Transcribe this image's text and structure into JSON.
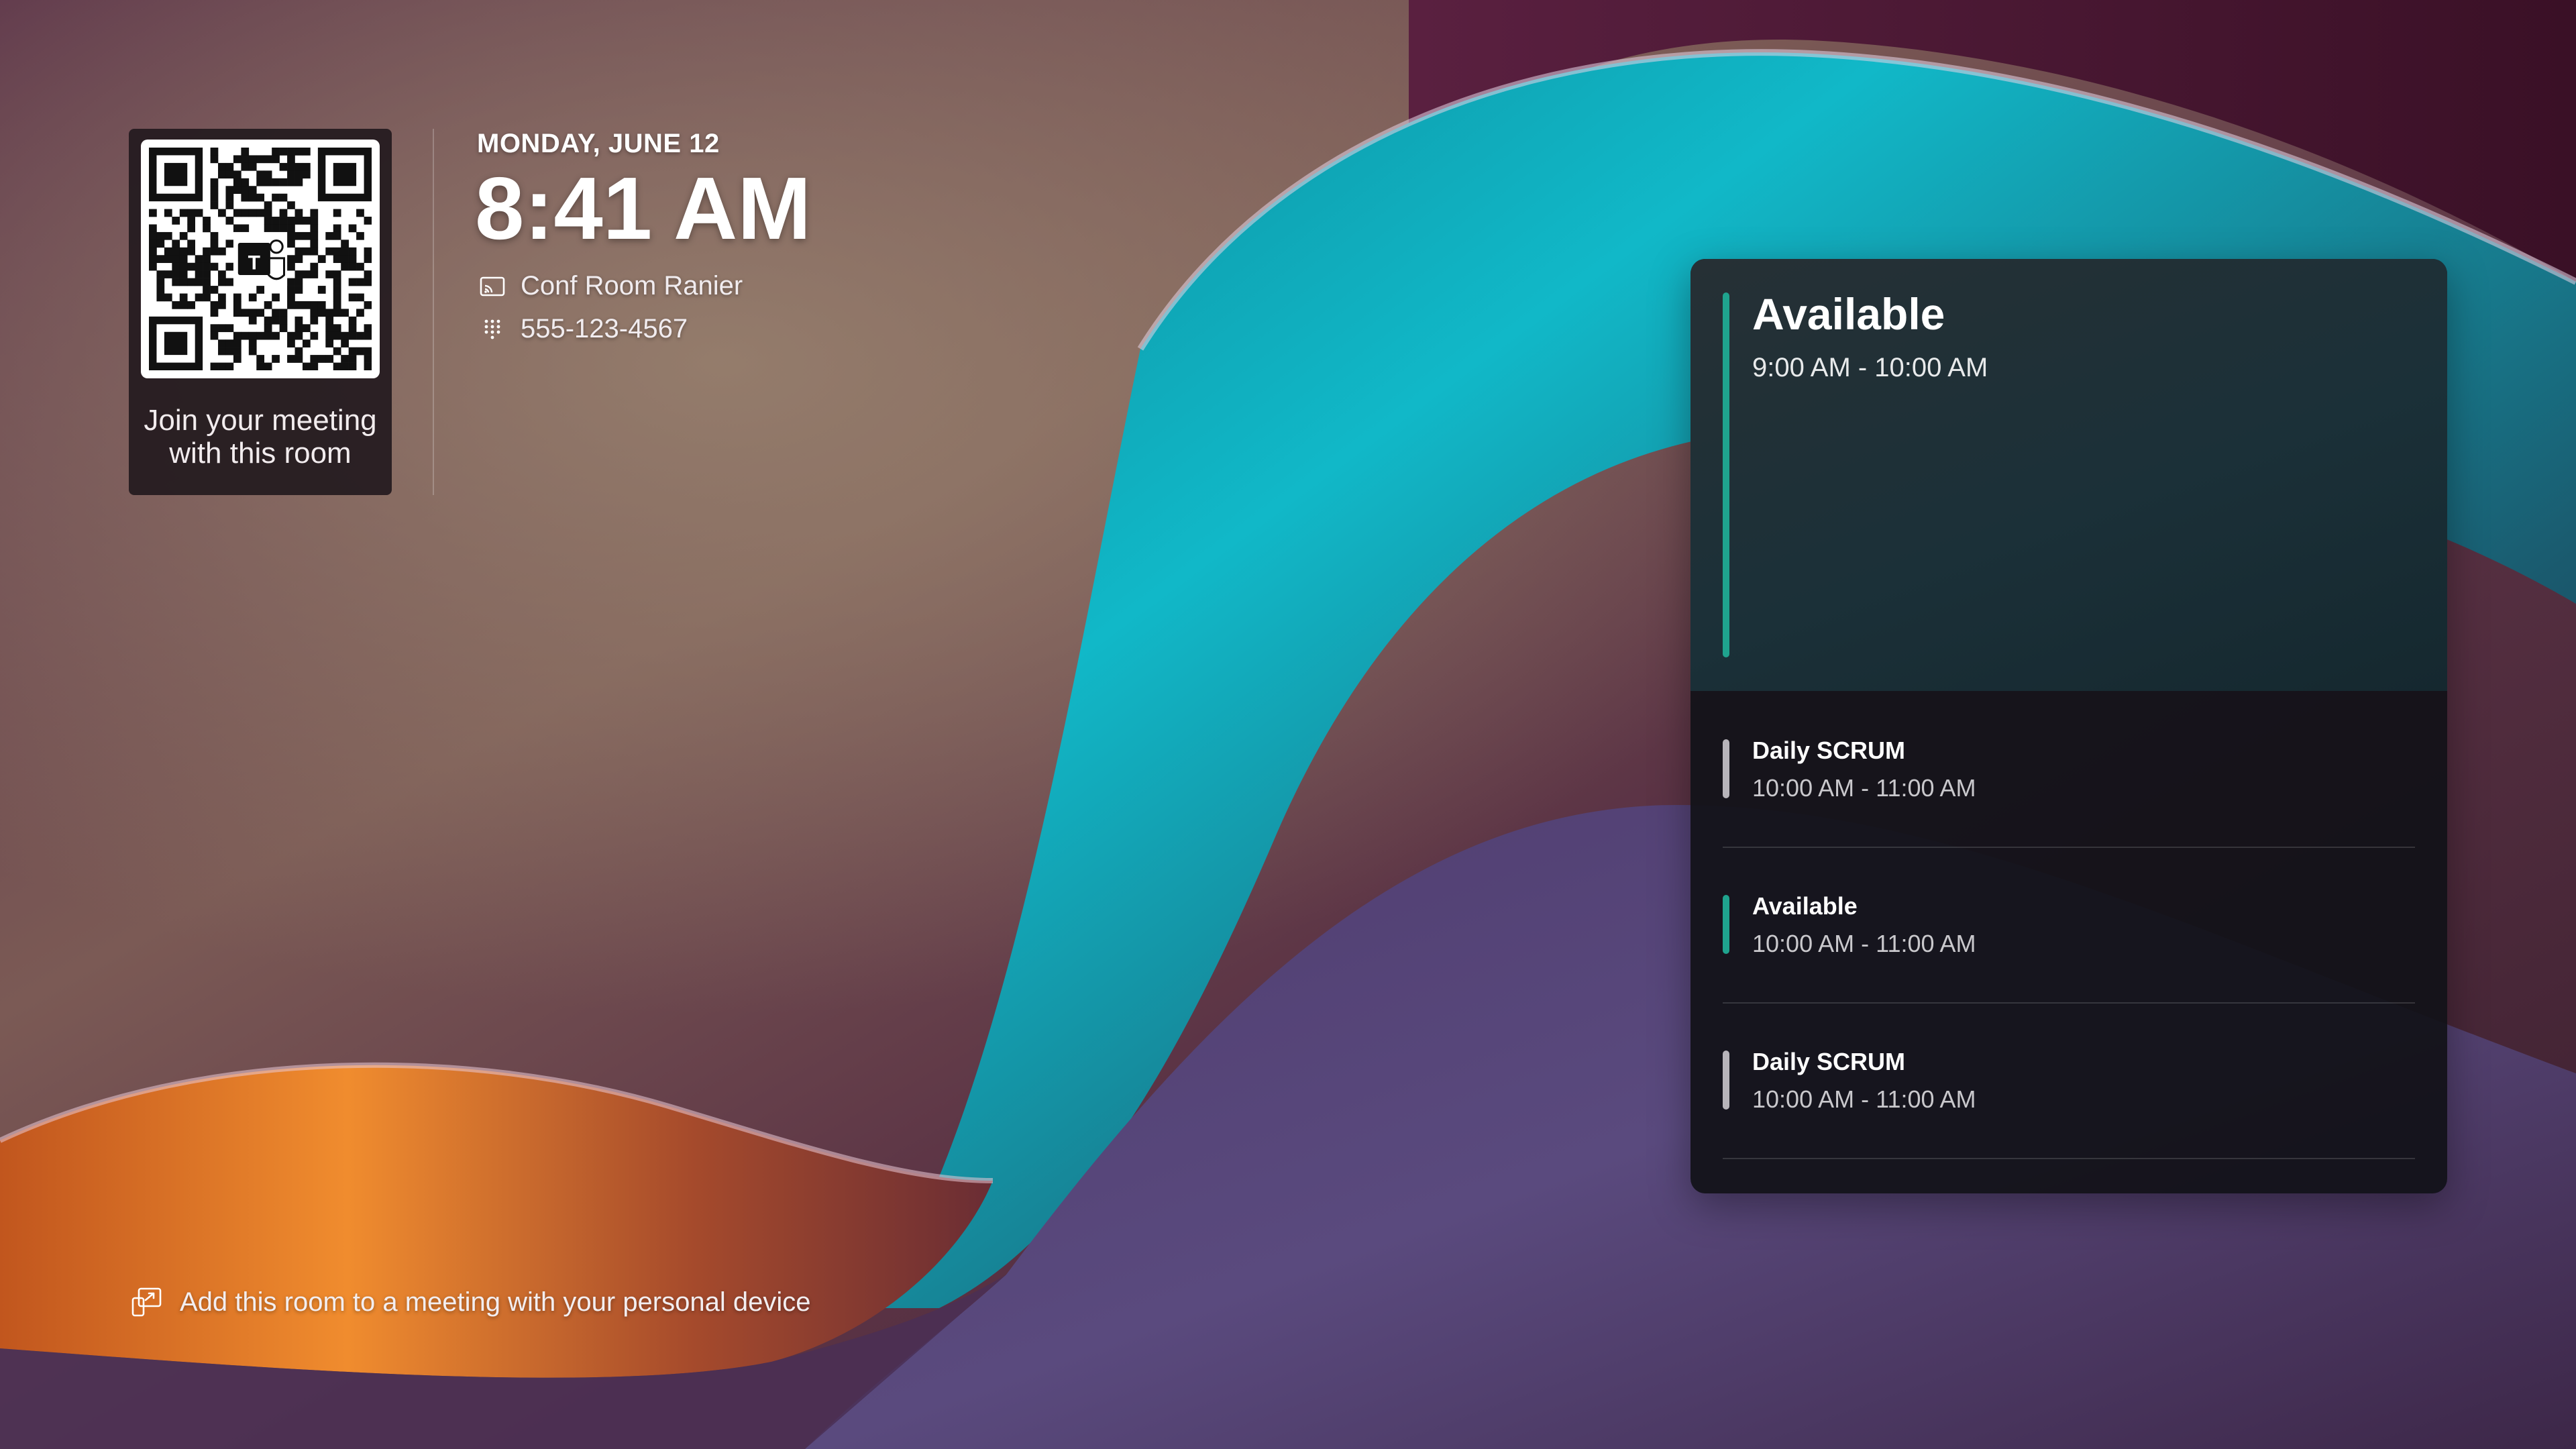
{
  "colors": {
    "accent_available": "#1fa38e",
    "accent_busy": "#b7b4ba",
    "panel_background": "#121218"
  },
  "qr": {
    "caption_line1": "Join your meeting",
    "caption_line2": "with this room",
    "center_logo": "T"
  },
  "clock": {
    "date": "MONDAY, JUNE 12",
    "time": "8:41 AM"
  },
  "room": {
    "name": "Conf Room Ranier",
    "name_icon": "cast-icon",
    "phone": "555-123-4567",
    "phone_icon": "dialpad-icon"
  },
  "schedule": {
    "current": {
      "title": "Available",
      "time": "9:00 AM - 10:00 AM",
      "status": "available"
    },
    "upcoming": [
      {
        "title": "Daily SCRUM",
        "time": "10:00 AM - 11:00 AM",
        "status": "busy"
      },
      {
        "title": "Available",
        "time": "10:00 AM - 11:00 AM",
        "status": "available"
      },
      {
        "title": "Daily SCRUM",
        "time": "10:00 AM - 11:00 AM",
        "status": "busy"
      }
    ]
  },
  "footer": {
    "label": "Add this room to a meeting with your personal device",
    "icon": "share-screen-icon"
  }
}
